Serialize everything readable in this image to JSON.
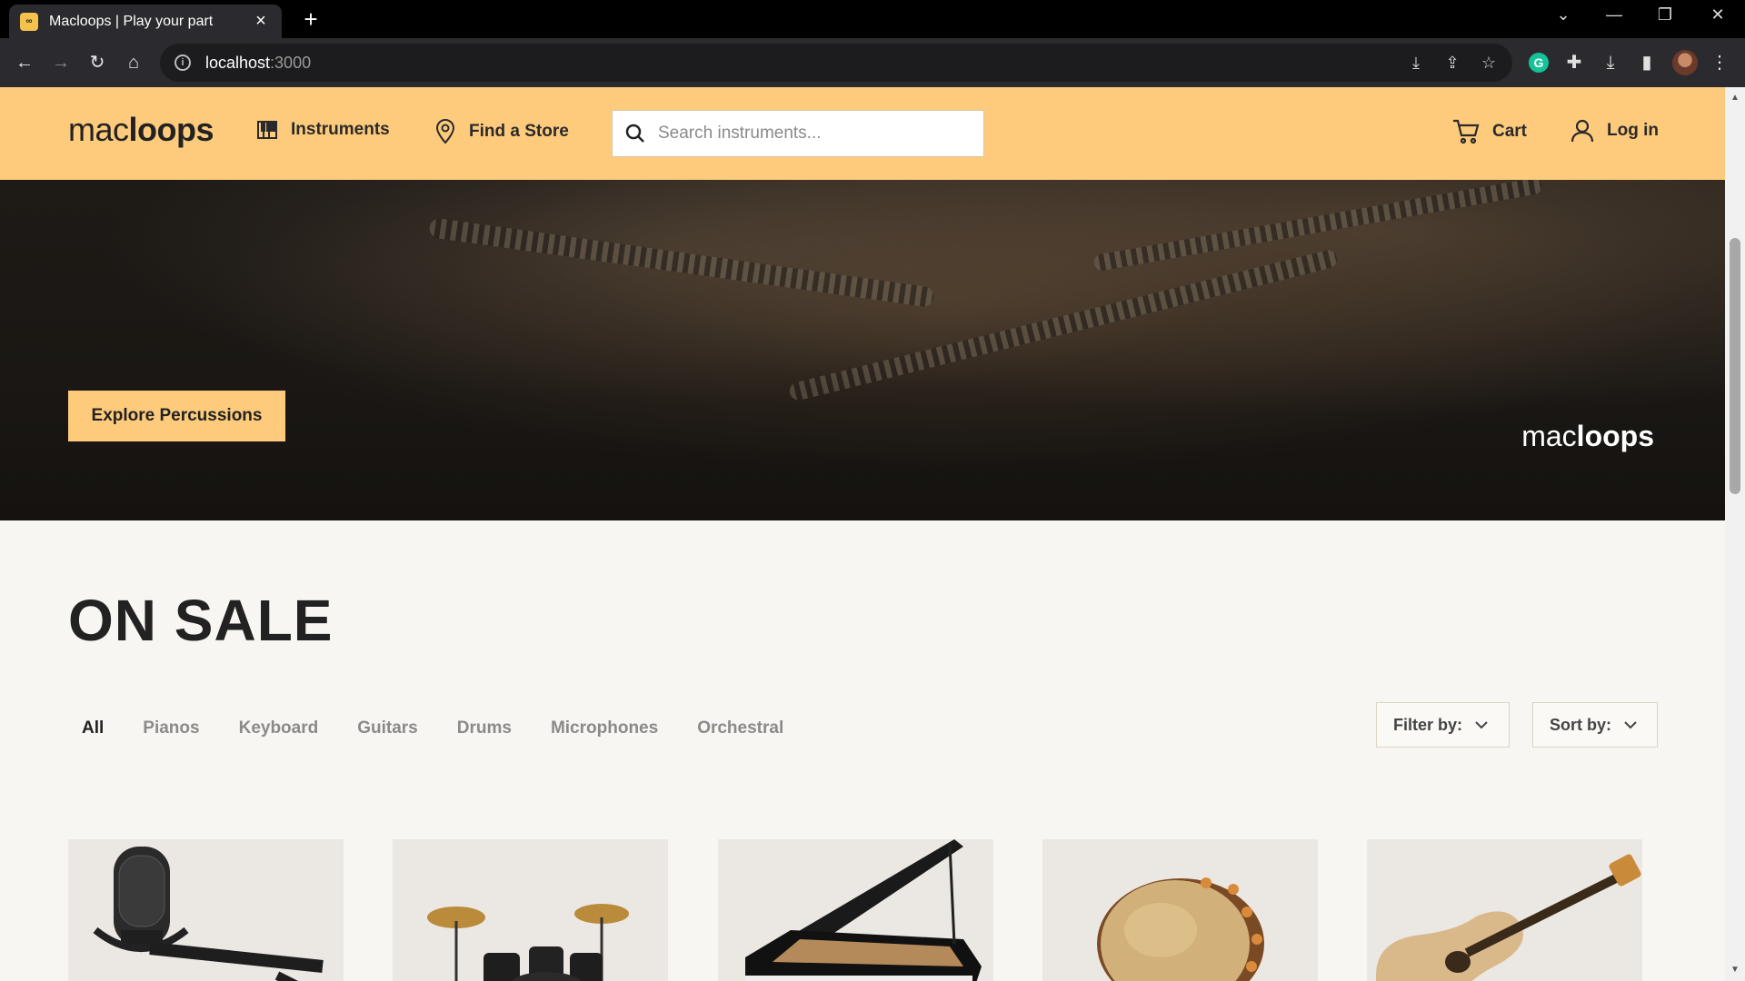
{
  "browser": {
    "tab_title": "Macloops | Play your part",
    "tab_favicon": "macloops-favicon",
    "url_host": "localhost",
    "url_port": ":3000",
    "window_controls": [
      "minimize",
      "restore",
      "close"
    ]
  },
  "header": {
    "logo_pre": "mac",
    "logo_bold": "loops",
    "nav": [
      {
        "label": "Instruments",
        "icon": "piano-keys-icon"
      },
      {
        "label": "Find a Store",
        "icon": "map-pin-icon"
      }
    ],
    "search_placeholder": "Search instruments...",
    "cart_label": "Cart",
    "login_label": "Log in"
  },
  "hero": {
    "button_label": "Explore Percussions",
    "logo_pre": "mac",
    "logo_bold": "loops"
  },
  "sale": {
    "title": "ON SALE",
    "categories": [
      "All",
      "Pianos",
      "Keyboard",
      "Guitars",
      "Drums",
      "Microphones",
      "Orchestral"
    ],
    "active_category": "All",
    "filter_label": "Filter by:",
    "sort_label": "Sort by:",
    "products": [
      {
        "kind": "microphone"
      },
      {
        "kind": "drum-kit"
      },
      {
        "kind": "grand-piano"
      },
      {
        "kind": "frame-drum"
      },
      {
        "kind": "acoustic-guitar"
      }
    ]
  },
  "colors": {
    "accent": "#fecb7d",
    "page_bg": "#f8f6f2",
    "text_dark": "#222222",
    "text_muted": "#8a8a8a"
  }
}
